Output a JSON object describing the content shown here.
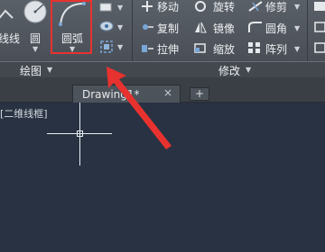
{
  "ribbon": {
    "draw": {
      "polyline_label": "线线",
      "circle_label": "圆",
      "arc_label": "圆弧",
      "panel_title": "绘图"
    },
    "modify": {
      "move": "移动",
      "rotate": "旋转",
      "trim": "修剪",
      "copy": "复制",
      "mirror": "镜像",
      "fillet": "圆角",
      "stretch": "拉伸",
      "scale": "缩放",
      "array": "阵列",
      "panel_title": "修改"
    }
  },
  "tabs": {
    "drawing_tab": "Drawing1*",
    "close": "×",
    "add": "+"
  },
  "viewport": {
    "label": "[二维线框]"
  },
  "colors": {
    "highlight": "#e8322f",
    "arrow": "#e8322f",
    "canvas": "#283242"
  },
  "icons": [
    "polyline-icon",
    "circle-icon",
    "arc-icon",
    "rectangle-icon",
    "hatch-icon",
    "move-icon",
    "rotate-icon",
    "trim-icon",
    "copy-icon",
    "mirror-icon",
    "fillet-icon",
    "stretch-icon",
    "scale-icon",
    "array-icon"
  ]
}
